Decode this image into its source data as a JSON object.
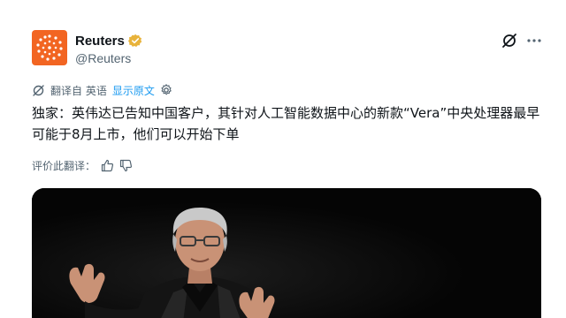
{
  "account": {
    "display_name": "Reuters",
    "handle": "@Reuters",
    "verified": true,
    "avatar_color": "#f26522"
  },
  "translation": {
    "label": "翻译自 英语",
    "show_original": "显示原文"
  },
  "tweet": {
    "text": "独家：英伟达已告知中国客户，其针对人工智能数据中心的新款“Vera”中央处理器最早可能于8月上市，他们可以开始下单"
  },
  "rate_translation": {
    "label": "评价此翻译："
  },
  "icons": {
    "avatar": "reuters-logo-icon",
    "verified": "verified-badge-icon",
    "grok": "grok-icon",
    "more": "more-icon",
    "translate": "translate-icon",
    "settings": "gear-icon",
    "thumb_up": "thumb-up-icon",
    "thumb_down": "thumb-down-icon"
  },
  "colors": {
    "accent_link": "#1d9bf0",
    "secondary_text": "#536471",
    "primary_text": "#0f1419",
    "media_background": "#050505"
  }
}
